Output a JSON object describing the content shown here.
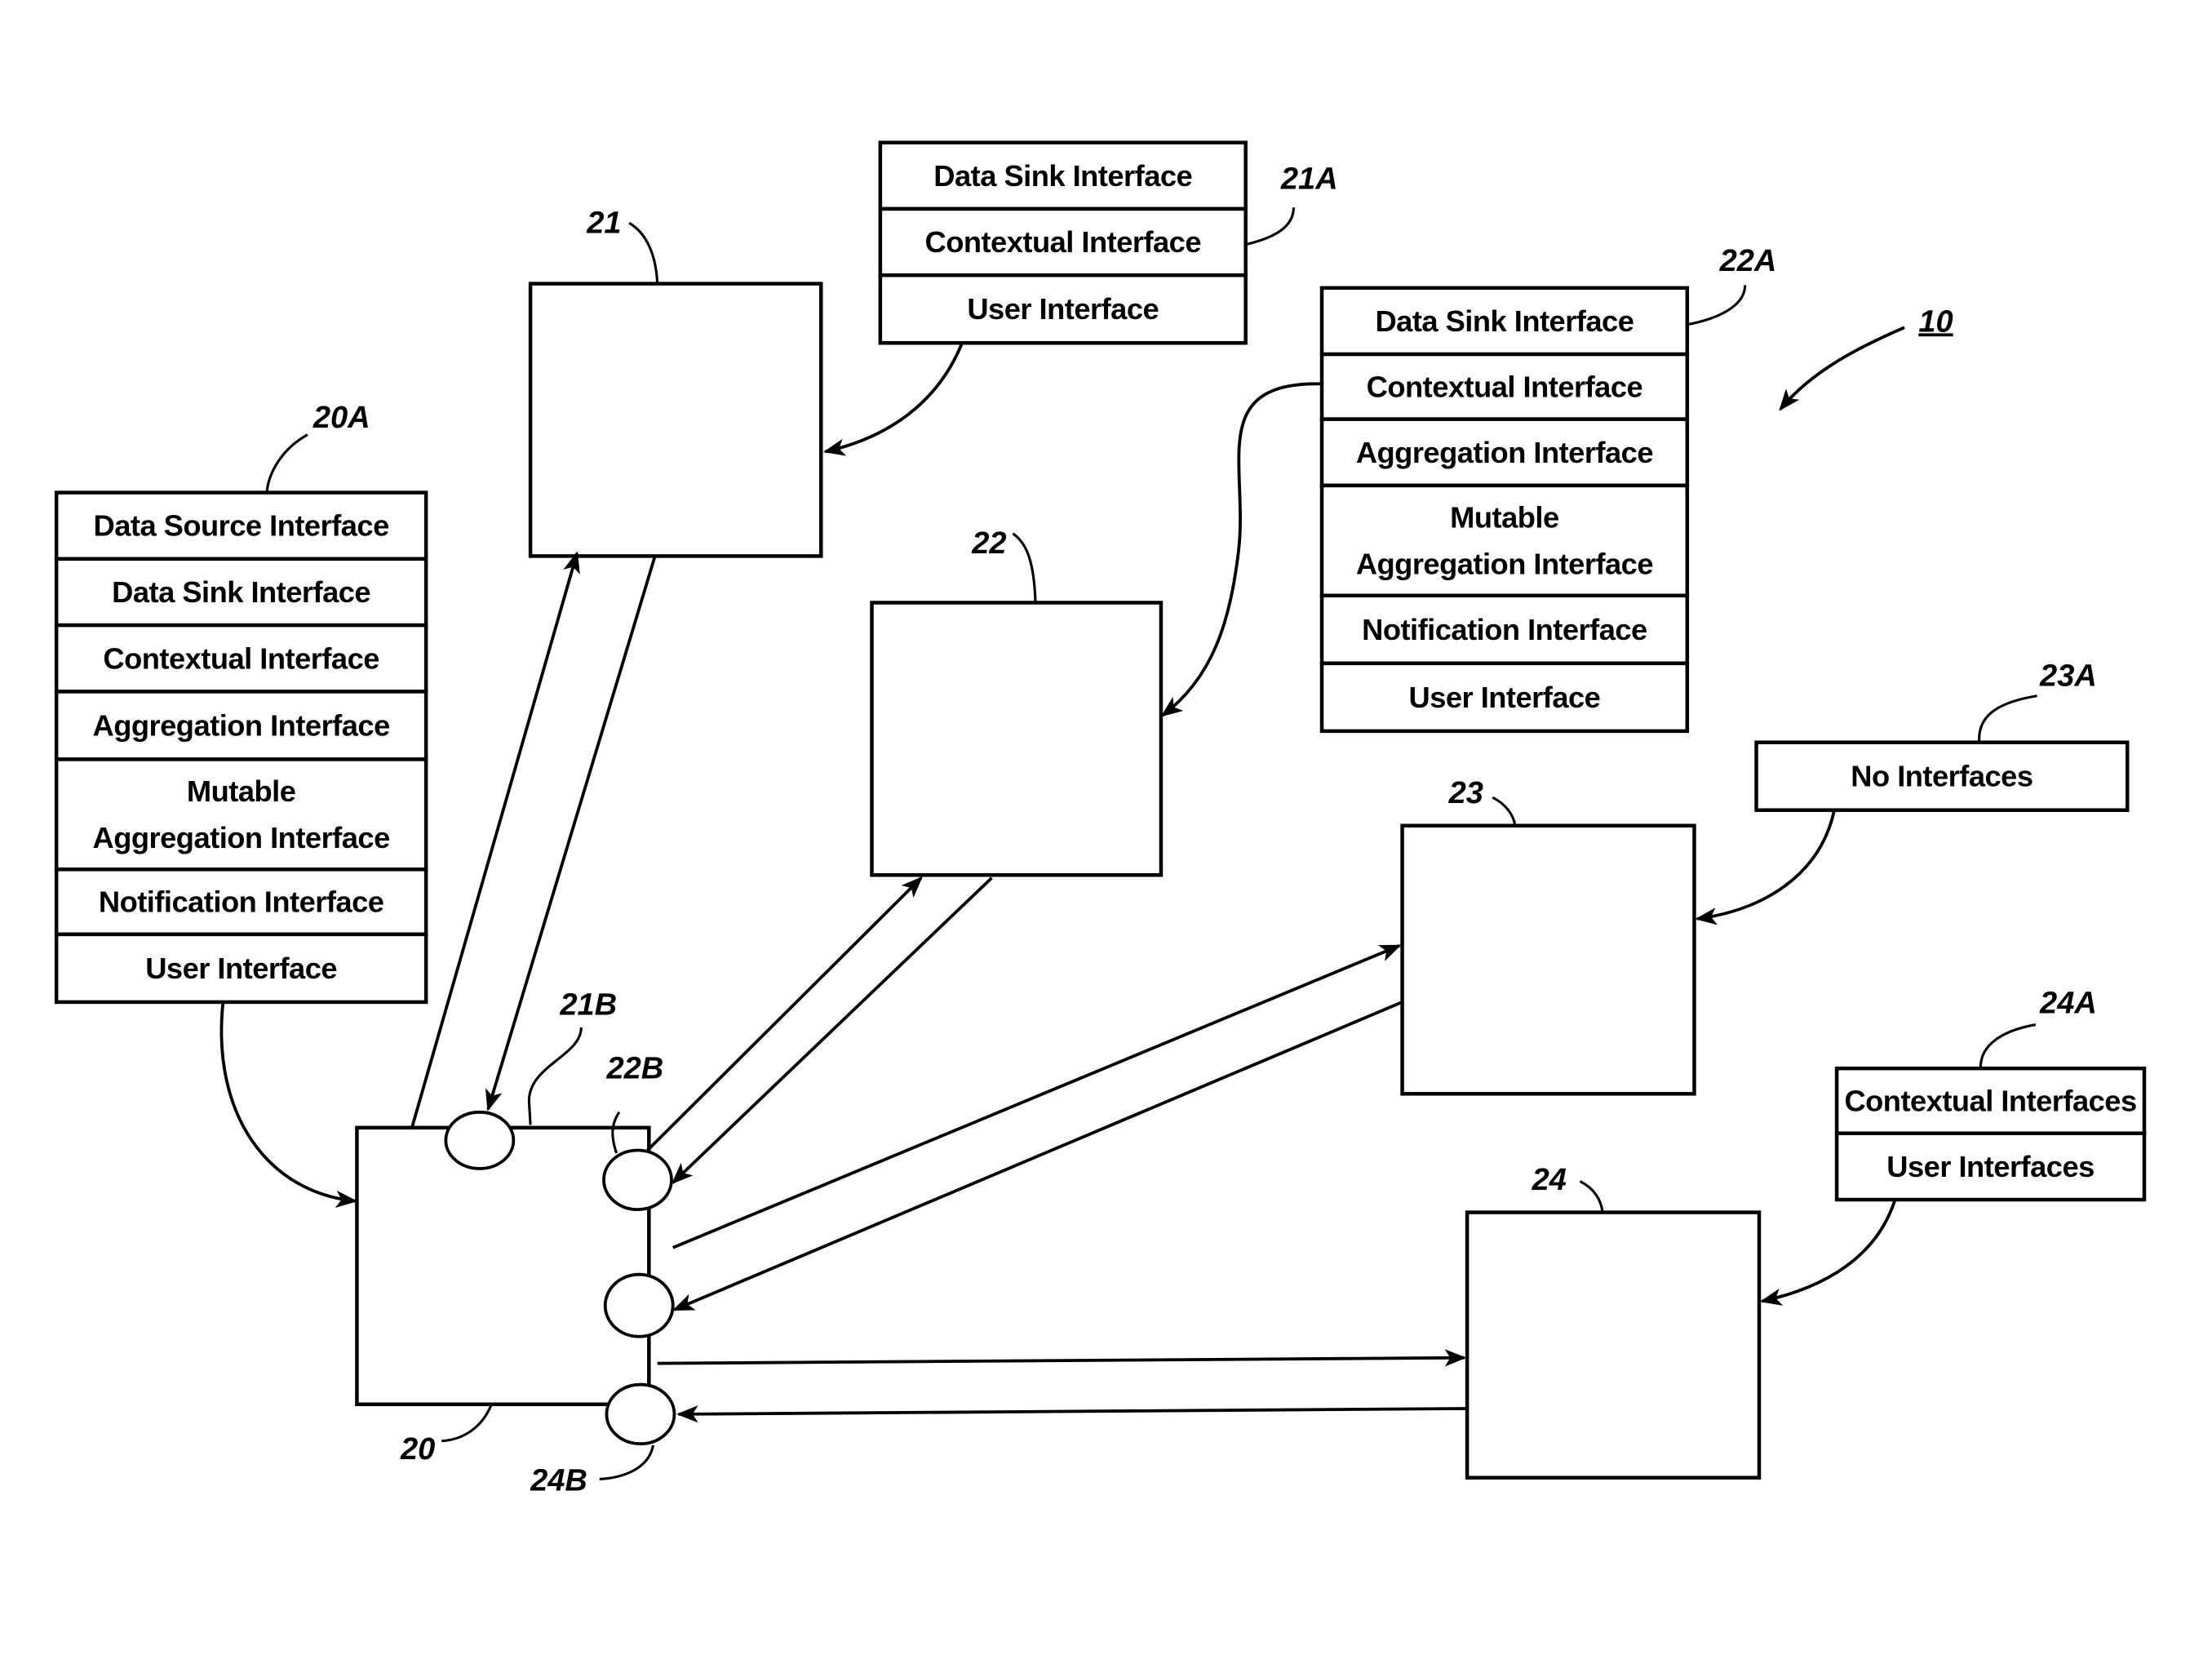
{
  "figure": {
    "system_ref": "10",
    "colors": {
      "ink": "#000000",
      "paper": "#ffffff"
    }
  },
  "components": {
    "c20": {
      "ref": "20"
    },
    "c21": {
      "ref": "21"
    },
    "c22": {
      "ref": "22"
    },
    "c23": {
      "ref": "23"
    },
    "c24": {
      "ref": "24"
    }
  },
  "ports": {
    "p21b": {
      "ref": "21B"
    },
    "p22b": {
      "ref": "22B"
    },
    "p24b": {
      "ref": "24B"
    }
  },
  "interface_tables": {
    "t20a": {
      "ref": "20A",
      "rows": [
        "Data Source Interface",
        "Data Sink Interface",
        "Contextual Interface",
        "Aggregation Interface",
        [
          "Mutable",
          "Aggregation Interface"
        ],
        "Notification Interface",
        "User Interface"
      ]
    },
    "t21a": {
      "ref": "21A",
      "rows": [
        "Data Sink Interface",
        "Contextual Interface",
        "User Interface"
      ]
    },
    "t22a": {
      "ref": "22A",
      "rows": [
        "Data Sink Interface",
        "Contextual Interface",
        "Aggregation Interface",
        [
          "Mutable",
          "Aggregation Interface"
        ],
        "Notification Interface",
        "User Interface"
      ]
    },
    "t23a": {
      "ref": "23A",
      "rows": [
        "No Interfaces"
      ]
    },
    "t24a": {
      "ref": "24A",
      "rows": [
        "Contextual Interfaces",
        "User Interfaces"
      ]
    }
  }
}
